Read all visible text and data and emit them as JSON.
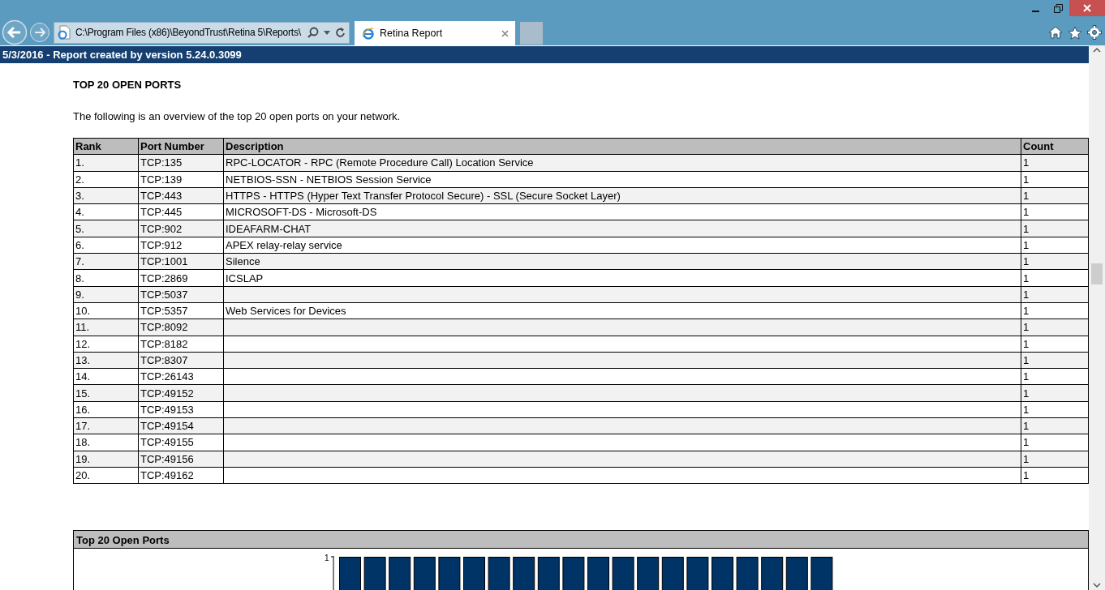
{
  "browser": {
    "address": "C:\\Program Files (x86)\\BeyondTrust\\Retina 5\\Reports\\",
    "tabs": [
      {
        "title": "Retina Report",
        "selected": true
      }
    ]
  },
  "report_header": "5/3/2016 - Report created by version 5.24.0.3099",
  "section_title": "TOP 20 OPEN PORTS",
  "intro": "The following is an overview of the top 20 open ports on your network.",
  "table": {
    "columns": [
      "Rank",
      "Port Number",
      "Description",
      "Count"
    ],
    "rows": [
      {
        "rank": "1.",
        "port": "TCP:135",
        "description": "RPC-LOCATOR - RPC (Remote Procedure Call) Location Service",
        "count": "1"
      },
      {
        "rank": "2.",
        "port": "TCP:139",
        "description": "NETBIOS-SSN - NETBIOS Session Service",
        "count": "1"
      },
      {
        "rank": "3.",
        "port": "TCP:443",
        "description": "HTTPS - HTTPS (Hyper Text Transfer Protocol Secure) - SSL (Secure Socket Layer)",
        "count": "1"
      },
      {
        "rank": "4.",
        "port": "TCP:445",
        "description": "MICROSOFT-DS - Microsoft-DS",
        "count": "1"
      },
      {
        "rank": "5.",
        "port": "TCP:902",
        "description": "IDEAFARM-CHAT",
        "count": "1"
      },
      {
        "rank": "6.",
        "port": "TCP:912",
        "description": "APEX relay-relay service",
        "count": "1"
      },
      {
        "rank": "7.",
        "port": "TCP:1001",
        "description": "Silence",
        "count": "1"
      },
      {
        "rank": "8.",
        "port": "TCP:2869",
        "description": "ICSLAP",
        "count": "1"
      },
      {
        "rank": "9.",
        "port": "TCP:5037",
        "count": "1"
      },
      {
        "rank": "10.",
        "port": "TCP:5357",
        "description": "Web Services for Devices",
        "count": "1"
      },
      {
        "rank": "11.",
        "port": "TCP:8092",
        "count": "1"
      },
      {
        "rank": "12.",
        "port": "TCP:8182",
        "count": "1"
      },
      {
        "rank": "13.",
        "port": "TCP:8307",
        "count": "1"
      },
      {
        "rank": "14.",
        "port": "TCP:26143",
        "count": "1"
      },
      {
        "rank": "15.",
        "port": "TCP:49152",
        "count": "1"
      },
      {
        "rank": "16.",
        "port": "TCP:49153",
        "count": "1"
      },
      {
        "rank": "17.",
        "port": "TCP:49154",
        "count": "1"
      },
      {
        "rank": "18.",
        "port": "TCP:49155",
        "count": "1"
      },
      {
        "rank": "19.",
        "port": "TCP:49156",
        "count": "1"
      },
      {
        "rank": "20.",
        "port": "TCP:49162",
        "count": "1"
      }
    ]
  },
  "chart_panel": {
    "title": "Top 20 Open Ports",
    "y_tick_label": "1"
  }
}
